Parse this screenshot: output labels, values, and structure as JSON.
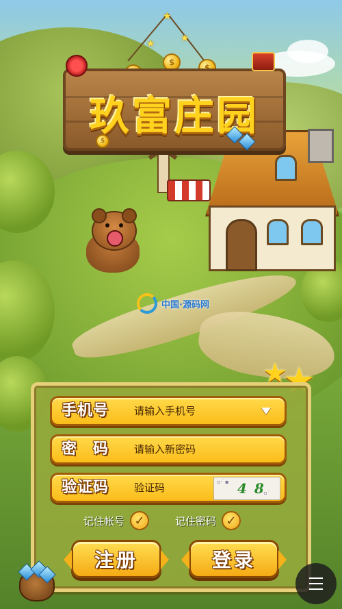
{
  "app": {
    "title": "玖富庄园"
  },
  "watermark": {
    "text": "中国·源码网"
  },
  "login": {
    "phone": {
      "label": "手机号",
      "placeholder": "请输入手机号"
    },
    "password": {
      "label": "密　码",
      "placeholder": "请输入新密码"
    },
    "captcha": {
      "label": "验证码",
      "placeholder": "验证码",
      "code": "4 8 0"
    },
    "remember_account": {
      "label": "记住帐号",
      "checked": true
    },
    "remember_password": {
      "label": "记住密码",
      "checked": true
    },
    "register_label": "注册",
    "login_label": "登录"
  },
  "icons": {
    "dropdown": "chevron-down-icon",
    "checkmark": "check-icon",
    "menu": "menu-icon",
    "coin": "coin-icon"
  },
  "colors": {
    "accent": "#fbbd1a",
    "field_border": "#a05a08",
    "panel": "#96aa3c",
    "title": "#ffd21e"
  }
}
